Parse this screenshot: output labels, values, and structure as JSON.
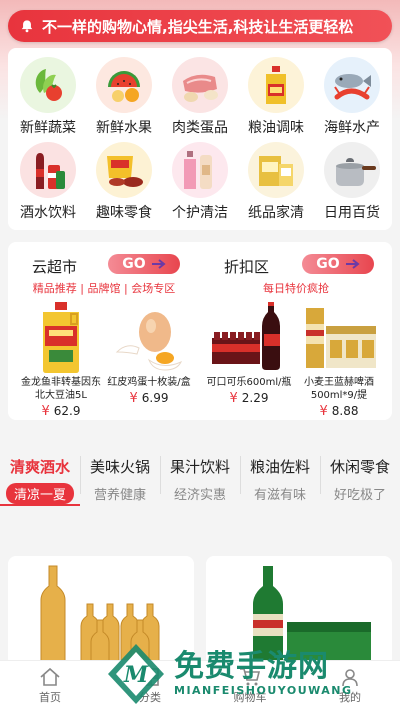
{
  "notice": {
    "icon": "bell-icon",
    "text": "不一样的购物心情,指尖生活,科技让生活更轻松"
  },
  "categories": [
    {
      "label": "新鲜蔬菜",
      "icon": "vegetable-icon",
      "color": "#7cc24a"
    },
    {
      "label": "新鲜水果",
      "icon": "fruit-icon",
      "color": "#e85a3c"
    },
    {
      "label": "肉类蛋品",
      "icon": "meat-icon",
      "color": "#e9a0a0"
    },
    {
      "label": "粮油调味",
      "icon": "oil-icon",
      "color": "#e6c13a"
    },
    {
      "label": "海鲜水产",
      "icon": "seafood-icon",
      "color": "#e8643c"
    },
    {
      "label": "酒水饮料",
      "icon": "drink-icon",
      "color": "#c9252d"
    },
    {
      "label": "趣味零食",
      "icon": "snack-icon",
      "color": "#f0c030"
    },
    {
      "label": "个护清洁",
      "icon": "cleaning-icon",
      "color": "#f0a0b8"
    },
    {
      "label": "纸品家清",
      "icon": "paper-icon",
      "color": "#e8c040"
    },
    {
      "label": "日用百货",
      "icon": "pot-icon",
      "color": "#c0c0c0"
    }
  ],
  "promo": {
    "supermarket": {
      "title": "云超市",
      "go": "GO",
      "sub": "精品推荐 | 品牌馆 | 会场专区",
      "products": [
        {
          "name": "金龙鱼非转基因东北大豆油5L",
          "price": "62.9",
          "currency": "¥"
        },
        {
          "name": "红皮鸡蛋十枚装/盒",
          "price": "6.99",
          "currency": "¥"
        }
      ]
    },
    "discount": {
      "title": "折扣区",
      "go": "GO",
      "sub": "每日特价疯抢",
      "products": [
        {
          "name": "可口可乐600ml/瓶",
          "price": "2.29",
          "currency": "¥"
        },
        {
          "name": "小麦王蓝赫啤酒500ml*9/提",
          "price": "8.88",
          "currency": "¥"
        }
      ]
    }
  },
  "tabs": [
    {
      "title": "清爽酒水",
      "subtitle": "清凉一夏"
    },
    {
      "title": "美味火锅",
      "subtitle": "营养健康"
    },
    {
      "title": "果汁饮料",
      "subtitle": "经济实惠"
    },
    {
      "title": "粮油佐料",
      "subtitle": "有滋有味"
    },
    {
      "title": "休闲零食",
      "subtitle": "好吃极了"
    }
  ],
  "bottom_nav": [
    {
      "label": "首页",
      "icon": "home-icon"
    },
    {
      "label": "分类",
      "icon": "category-icon"
    },
    {
      "label": "购物车",
      "icon": "cart-icon"
    },
    {
      "label": "我的",
      "icon": "user-icon"
    }
  ],
  "watermark": {
    "cn": "免费手游网",
    "en": "MIANFEISHOUYOUWANG"
  },
  "colors": {
    "accent": "#e8343d",
    "watermark": "#1a8a6e"
  }
}
